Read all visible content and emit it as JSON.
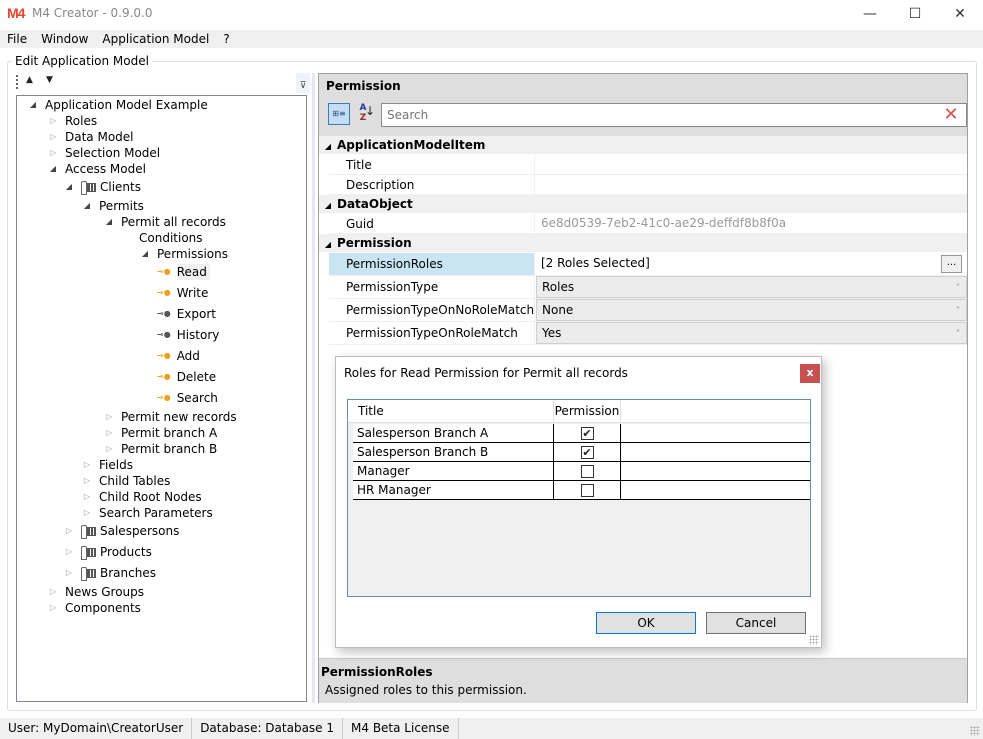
{
  "window": {
    "logo": "M4",
    "title": "M4 Creator - 0.9.0.0",
    "minimize_glyph": "—",
    "maximize_glyph": "☐",
    "close_glyph": "✕"
  },
  "menu": [
    "File",
    "Window",
    "Application Model",
    "?"
  ],
  "group_label": "Edit Application Model",
  "tree_toolbar": {
    "up_glyph": "▲",
    "down_glyph": "▼",
    "overflow_glyph": "⊽"
  },
  "tree": [
    {
      "label": "Application Model Example",
      "expander": "expanded",
      "icon": "none"
    },
    {
      "label": "Roles",
      "expander": "collapsed",
      "icon": "none"
    },
    {
      "label": "Data Model",
      "expander": "collapsed",
      "icon": "none"
    },
    {
      "label": "Selection Model",
      "expander": "collapsed",
      "icon": "none"
    },
    {
      "label": "Access Model",
      "expander": "expanded",
      "icon": "none"
    },
    {
      "label": "Clients",
      "expander": "expanded",
      "icon": "table-icon"
    },
    {
      "label": "Permits",
      "expander": "expanded",
      "icon": "none"
    },
    {
      "label": "Permit all records",
      "expander": "expanded",
      "icon": "none"
    },
    {
      "label": "Conditions",
      "expander": "none",
      "icon": "none"
    },
    {
      "label": "Permissions",
      "expander": "expanded",
      "icon": "none"
    },
    {
      "label": "Read",
      "expander": "none",
      "icon": "key-gold",
      "selected": true
    },
    {
      "label": "Write",
      "expander": "none",
      "icon": "key-gold"
    },
    {
      "label": "Export",
      "expander": "none",
      "icon": "key-gray"
    },
    {
      "label": "History",
      "expander": "none",
      "icon": "key-gray"
    },
    {
      "label": "Add",
      "expander": "none",
      "icon": "key-gold"
    },
    {
      "label": "Delete",
      "expander": "none",
      "icon": "key-gold"
    },
    {
      "label": "Search",
      "expander": "none",
      "icon": "key-gold"
    },
    {
      "label": "Permit new records",
      "expander": "collapsed",
      "icon": "none"
    },
    {
      "label": "Permit branch A",
      "expander": "collapsed",
      "icon": "none"
    },
    {
      "label": "Permit branch B",
      "expander": "collapsed",
      "icon": "none"
    },
    {
      "label": "Fields",
      "expander": "collapsed",
      "icon": "none"
    },
    {
      "label": "Child Tables",
      "expander": "collapsed",
      "icon": "none"
    },
    {
      "label": "Child Root Nodes",
      "expander": "collapsed",
      "icon": "none"
    },
    {
      "label": "Search Parameters",
      "expander": "collapsed",
      "icon": "none"
    },
    {
      "label": "Salespersons",
      "expander": "collapsed",
      "icon": "table-icon"
    },
    {
      "label": "Products",
      "expander": "collapsed",
      "icon": "table-icon"
    },
    {
      "label": "Branches",
      "expander": "collapsed",
      "icon": "table-icon"
    },
    {
      "label": "News Groups",
      "expander": "collapsed",
      "icon": "none"
    },
    {
      "label": "Components",
      "expander": "collapsed",
      "icon": "none"
    }
  ],
  "property_grid": {
    "title": "Permission",
    "search_placeholder": "Search",
    "search_value": "",
    "clear_glyph": "✕",
    "categories": [
      {
        "name": "ApplicationModelItem",
        "rows": [
          {
            "name": "Title",
            "value": ""
          },
          {
            "name": "Description",
            "value": ""
          }
        ]
      },
      {
        "name": "DataObject",
        "rows": [
          {
            "name": "Guid",
            "value": "6e8d0539-7eb2-41c0-ae29-deffdf8b8f0a"
          }
        ]
      },
      {
        "name": "Permission",
        "rows": [
          {
            "name": "PermissionRoles",
            "value": "[2 Roles Selected]"
          },
          {
            "name": "PermissionType",
            "value": "Roles"
          },
          {
            "name": "PermissionTypeOnNoRoleMatch",
            "value": "None"
          },
          {
            "name": "PermissionTypeOnRoleMatch",
            "value": "Yes"
          }
        ]
      }
    ],
    "ellipsis_label": "...",
    "combo_arrow": "˅",
    "description_title": "PermissionRoles",
    "description_text": "Assigned roles to this permission."
  },
  "dialog": {
    "title": "Roles for Read Permission for Permit all records",
    "close_label": "x",
    "columns": [
      "Title",
      "Permission"
    ],
    "rows": [
      {
        "title": "Salesperson Branch A",
        "permission": true
      },
      {
        "title": "Salesperson Branch B",
        "permission": true
      },
      {
        "title": "Manager",
        "permission": false
      },
      {
        "title": "HR Manager",
        "permission": false
      }
    ],
    "ok_label": "OK",
    "cancel_label": "Cancel"
  },
  "status": {
    "user": "User: MyDomain\\CreatorUser",
    "database": "Database: Database 1",
    "license": "M4 Beta License"
  }
}
